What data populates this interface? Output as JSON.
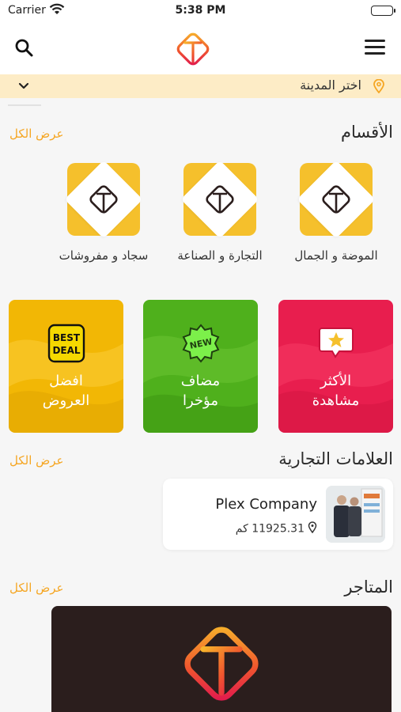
{
  "status_bar": {
    "carrier": "Carrier",
    "time": "5:38 PM"
  },
  "nav": {
    "logo_icon": "app-logo-icon",
    "search_icon": "search-icon",
    "menu_icon": "hamburger-menu-icon"
  },
  "city_selector": {
    "label": "اختر المدينة",
    "pin_icon": "location-pin-icon",
    "chevron_icon": "chevron-down-icon"
  },
  "categories": {
    "title": "الأقسام",
    "view_all": "عرض الكل",
    "items": [
      {
        "label": "الموضة و الجمال"
      },
      {
        "label": "التجارة و الصناعة"
      },
      {
        "label": "سجاد و مفروشات"
      }
    ]
  },
  "promos": [
    {
      "line1": "الأكثر",
      "line2": "مشاهدة",
      "color": "#e81e4e",
      "icon": "star-message-icon"
    },
    {
      "line1": "مضاف",
      "line2": "مؤخرا",
      "color": "#4fb01c",
      "icon": "new-badge-icon",
      "badge_text": "NEW"
    },
    {
      "line1": "افضل",
      "line2": "العروض",
      "color": "#f2b705",
      "icon": "best-deal-icon",
      "badge_line1": "BEST",
      "badge_line2": "DEAL"
    }
  ],
  "brands": {
    "title": "العلامات التجارية",
    "view_all": "عرض الكل",
    "items": [
      {
        "name": "Plex Company",
        "distance": "11925.31 كم"
      }
    ]
  },
  "stores": {
    "title": "المتاجر",
    "view_all": "عرض الكل"
  },
  "colors": {
    "accent": "#f5a623",
    "city_bar": "#fdecc6",
    "tile_yellow": "#f5c02c",
    "store_bg": "#2b1e1d"
  }
}
